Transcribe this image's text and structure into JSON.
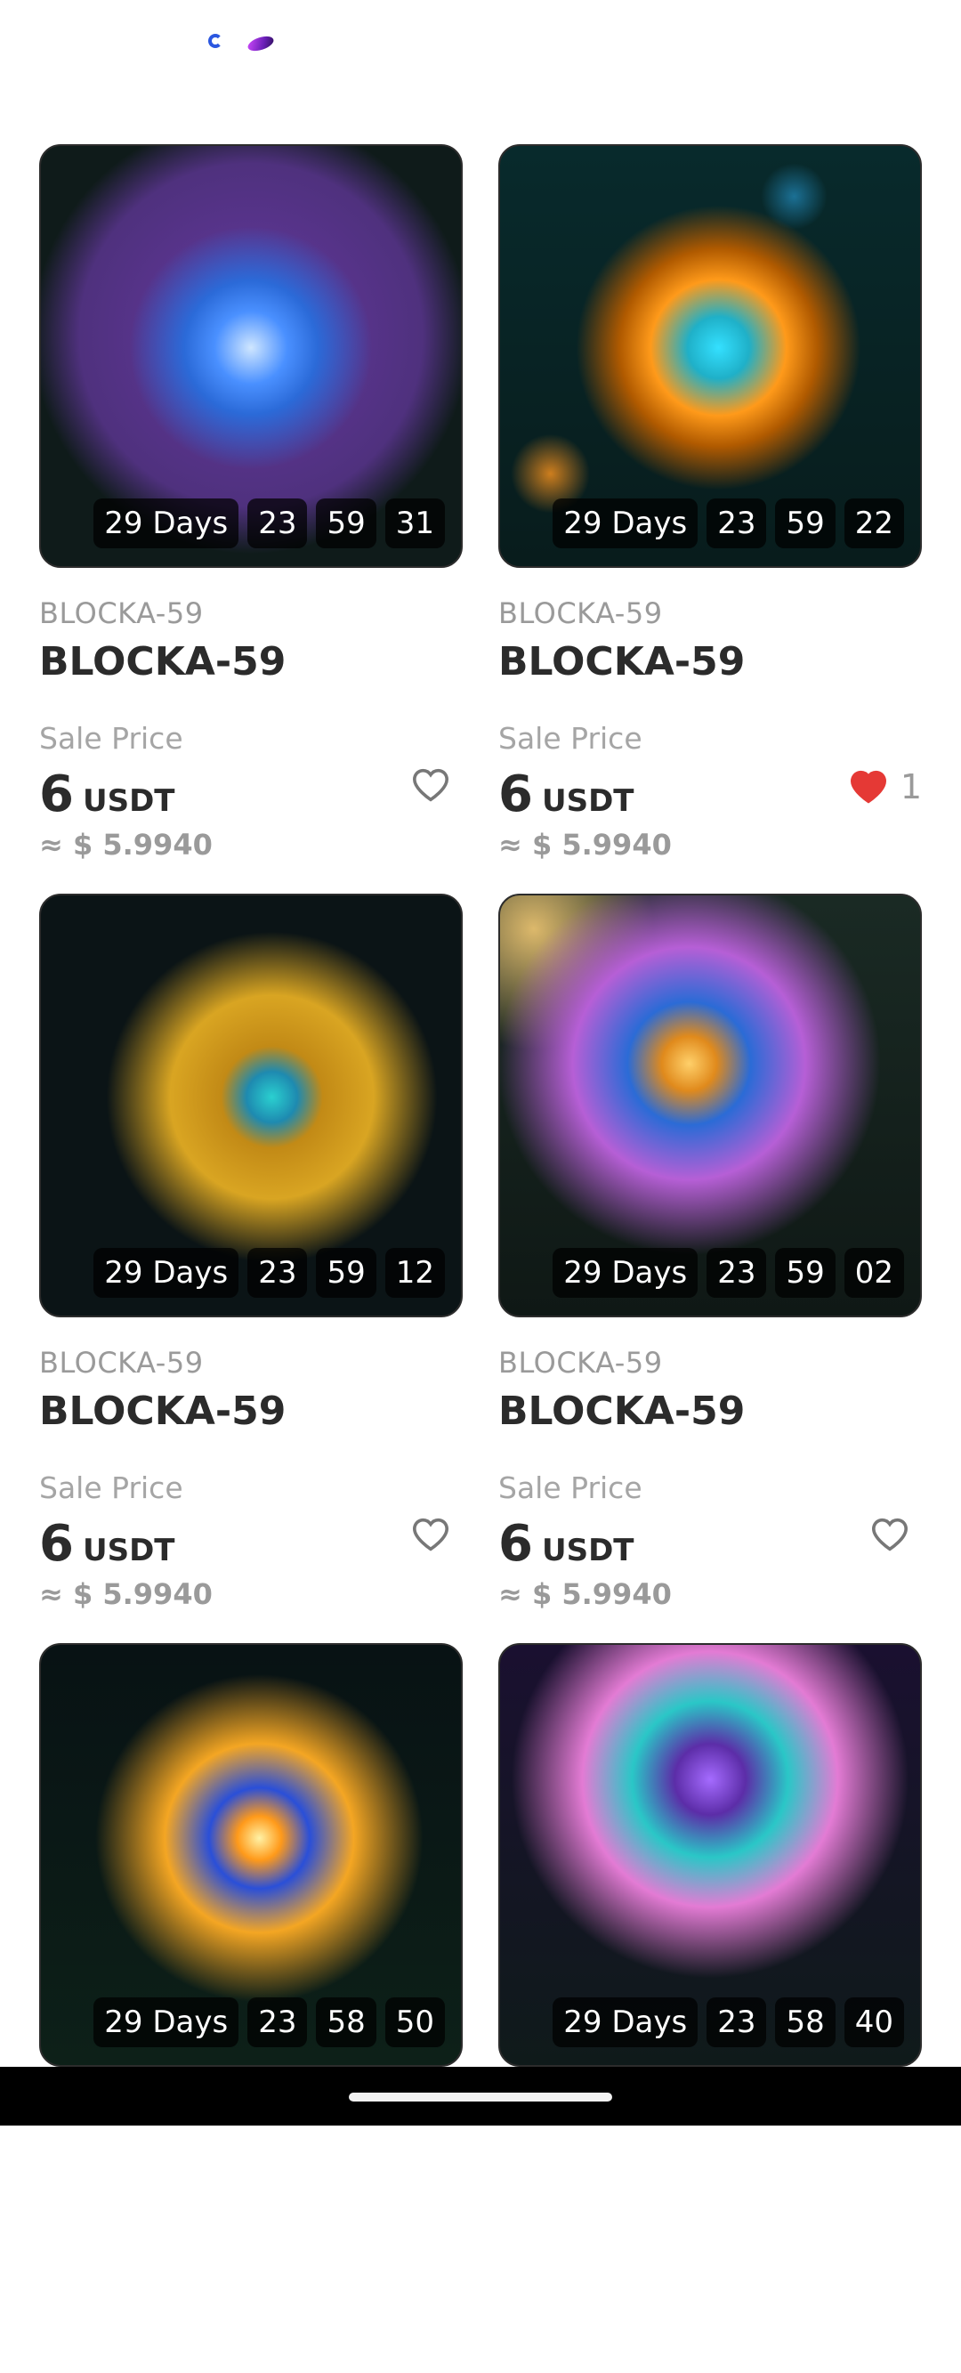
{
  "top": {
    "icons": [
      "app-icon-blue",
      "app-icon-purple"
    ]
  },
  "cards": [
    {
      "subtitle": "BLOCKA-59",
      "title": "BLOCKA-59",
      "sale_label": "Sale Price",
      "price_value": "6",
      "price_unit": "USDT",
      "fiat": "≈ $ 5.9940",
      "liked": false,
      "like_count": "",
      "timer": {
        "days": "29 Days",
        "hours": "23",
        "minutes": "59",
        "seconds": "31"
      },
      "image_colors": [
        "#6a3aa8",
        "#2b6ad8",
        "#0f1b1a"
      ]
    },
    {
      "subtitle": "BLOCKA-59",
      "title": "BLOCKA-59",
      "sale_label": "Sale Price",
      "price_value": "6",
      "price_unit": "USDT",
      "fiat": "≈ $ 5.9940",
      "liked": true,
      "like_count": "1",
      "timer": {
        "days": "29 Days",
        "hours": "23",
        "minutes": "59",
        "seconds": "22"
      },
      "image_colors": [
        "#ff9a1a",
        "#1fb0c8",
        "#082a2c"
      ]
    },
    {
      "subtitle": "BLOCKA-59",
      "title": "BLOCKA-59",
      "sale_label": "Sale Price",
      "price_value": "6",
      "price_unit": "USDT",
      "fiat": "≈ $ 5.9940",
      "liked": false,
      "like_count": "",
      "timer": {
        "days": "29 Days",
        "hours": "23",
        "minutes": "59",
        "seconds": "12"
      },
      "image_colors": [
        "#d9a522",
        "#1e8ab0",
        "#0b1416"
      ]
    },
    {
      "subtitle": "BLOCKA-59",
      "title": "BLOCKA-59",
      "sale_label": "Sale Price",
      "price_value": "6",
      "price_unit": "USDT",
      "fiat": "≈ $ 5.9940",
      "liked": false,
      "like_count": "",
      "timer": {
        "days": "29 Days",
        "hours": "23",
        "minutes": "59",
        "seconds": "02"
      },
      "image_colors": [
        "#b65fd6",
        "#2b6bd6",
        "#1a2a24"
      ]
    },
    {
      "subtitle": "",
      "title": "",
      "sale_label": "",
      "price_value": "",
      "price_unit": "",
      "fiat": "",
      "liked": false,
      "like_count": "",
      "timer": {
        "days": "29 Days",
        "hours": "23",
        "minutes": "58",
        "seconds": "50"
      },
      "image_colors": [
        "#f4a623",
        "#2a4fd8",
        "#081214"
      ]
    },
    {
      "subtitle": "",
      "title": "",
      "sale_label": "",
      "price_value": "",
      "price_unit": "",
      "fiat": "",
      "liked": false,
      "like_count": "",
      "timer": {
        "days": "29 Days",
        "hours": "23",
        "minutes": "58",
        "seconds": "40"
      },
      "image_colors": [
        "#e37bd4",
        "#2ac7c7",
        "#1a1030"
      ]
    }
  ],
  "colors": {
    "heart_filled": "#e53935",
    "heart_outline": "#777777"
  }
}
